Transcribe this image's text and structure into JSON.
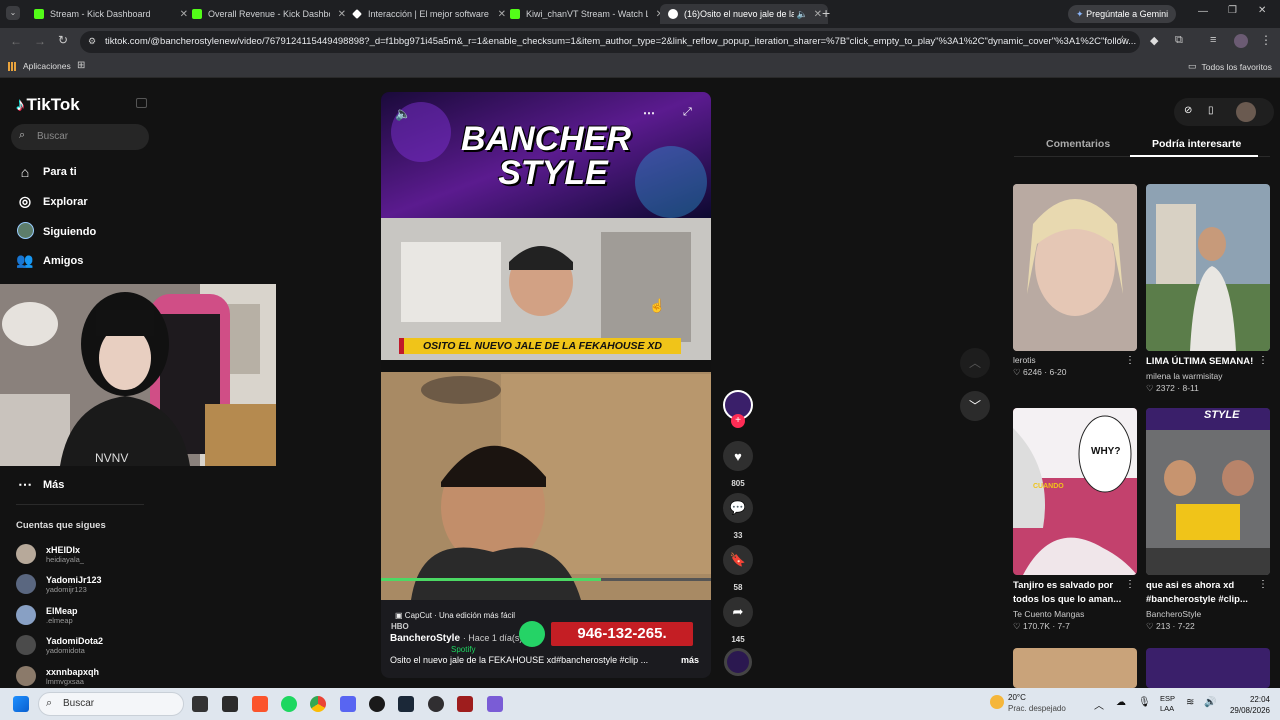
{
  "browser": {
    "tabs": [
      {
        "title": "Stream - Kick Dashboard",
        "icon": "kick-icon",
        "color": "#53fc18"
      },
      {
        "title": "Overall Revenue - Kick Dashboard",
        "icon": "kick-icon",
        "color": "#53fc18"
      },
      {
        "title": "Interacción | El mejor software",
        "icon": "diamond-icon",
        "color": "#ffffff"
      },
      {
        "title": "Kiwi_chanVT Stream - Watch Live",
        "icon": "kick-icon",
        "color": "#53fc18"
      },
      {
        "title": "(16)Osito el nuevo jale de la",
        "icon": "tiktok-icon",
        "color": "#ffffff"
      }
    ],
    "gemini_label": "Pregúntale a Gemini",
    "url": "tiktok.com/@bancherostylenew/video/7679124115449498898?_d=f1bbg971i45a5m&_r=1&enable_checksum=1&item_author_type=2&link_reflow_popup_iteration_sharer=%7B\"click_empty_to_play\"%3A1%2C\"dynamic_cover\"%3A1%2C\"follow...",
    "bookmarks": {
      "apps": "Aplicaciones",
      "all": "Todos los favoritos"
    }
  },
  "tiktok": {
    "logo": "TikTok",
    "search_placeholder": "Buscar",
    "nav": [
      {
        "label": "Para ti",
        "icon": "home-icon"
      },
      {
        "label": "Explorar",
        "icon": "compass-icon"
      },
      {
        "label": "Siguiendo",
        "icon": "following-icon"
      },
      {
        "label": "Amigos",
        "icon": "friends-icon"
      }
    ],
    "more_label": "Más",
    "following_title": "Cuentas que sigues",
    "following": [
      {
        "name": "xHEIDIx",
        "handle": "heidiayala_"
      },
      {
        "name": "YadomiJr123",
        "handle": "yadomijr123"
      },
      {
        "name": "ElMeap",
        "handle": ".elmeap"
      },
      {
        "name": "YadomiDota2",
        "handle": "yadomidota"
      },
      {
        "name": "xxnnbapxqh",
        "handle": "lmmvgxsaa"
      }
    ]
  },
  "video": {
    "banner_text_1": "BANCHER",
    "banner_text_2": "STYLE",
    "caption_bar": "OSITO EL NUEVO JALE DE LA FEKAHOUSE XD",
    "capcut": "CapCut · Una edición más fácil",
    "author": "BancheroStyle",
    "time": "· Hace 1 día(s)",
    "phone": "946-132-265.",
    "description": "Osito el nuevo jale de la FEKAHOUSE xd#bancherostyle #clip ...",
    "more": "más",
    "hbo": "HBO",
    "spotify": "Spotify"
  },
  "actions": {
    "likes": "805",
    "comments": "33",
    "saves": "58",
    "shares": "145"
  },
  "right_panel": {
    "tab_comments": "Comentarios",
    "tab_suggested": "Podría interesarte",
    "cards": [
      {
        "title": "",
        "author": "lerotis",
        "likes": "6246",
        "date": "6-20",
        "bg": "#b9aaa2"
      },
      {
        "title": "LIMA ÚLTIMA SEMANA!",
        "author": "milena la warmisitay",
        "likes": "2372",
        "date": "8-11",
        "bg": "#8ea2b3"
      },
      {
        "title": "Tanjiro es salvado por todos los que lo aman...",
        "author": "Te Cuento Mangas",
        "likes": "170.7K",
        "date": "7-7",
        "bg": "#c3416d",
        "overlay": "WHY?",
        "overlay2": "CUANDO"
      },
      {
        "title": "que asi es ahora xd #bancherostyle #clip...",
        "author": "BancheroStyle",
        "likes": "213",
        "date": "7-22",
        "bg": "#4b4f57",
        "overlay": "STYLE"
      }
    ]
  },
  "taskbar": {
    "search": "Buscar",
    "weather_temp": "20°C",
    "weather_desc": "Prac. despejado",
    "lang1": "ESP",
    "lang2": "LAA",
    "time": "22:04",
    "date": "29/08/2026"
  }
}
